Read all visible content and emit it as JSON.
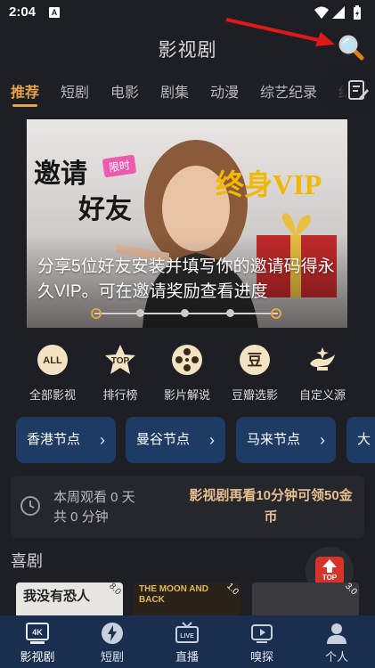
{
  "status": {
    "time": "2:04",
    "notif_icon_letter": "A"
  },
  "header": {
    "title": "影视剧",
    "search_icon": "search-icon"
  },
  "tabs": [
    {
      "label": "推荐",
      "active": true
    },
    {
      "label": "短剧"
    },
    {
      "label": "电影"
    },
    {
      "label": "剧集"
    },
    {
      "label": "动漫"
    },
    {
      "label": "综艺纪录"
    },
    {
      "label": "纪"
    }
  ],
  "banner": {
    "headline_1": "邀请",
    "headline_2": "好友",
    "badge": "限时",
    "tagline": "终身VIP",
    "caption": "分享5位好友安装并填写你的邀请码得永久VIP。可在邀请奖励查看进度",
    "slide_count": 5,
    "active_slides": [
      0,
      4
    ]
  },
  "quick_links": [
    {
      "label": "全部影视",
      "icon": "all-icon",
      "icon_text": "ALL"
    },
    {
      "label": "排行榜",
      "icon": "top-ranking-icon",
      "icon_text": "TOP"
    },
    {
      "label": "影片解说",
      "icon": "film-reel-icon"
    },
    {
      "label": "豆瓣选影",
      "icon": "douban-icon",
      "icon_text": "豆"
    },
    {
      "label": "自定义源",
      "icon": "magic-lamp-icon"
    }
  ],
  "nodes": [
    {
      "label": "香港节点"
    },
    {
      "label": "曼谷节点"
    },
    {
      "label": "马来节点"
    },
    {
      "label": "大"
    }
  ],
  "watch": {
    "line1": "本周观看 0 天",
    "line2": "共 0 分钟",
    "promo": "影视剧再看10分钟可领50金币"
  },
  "section": {
    "title": "喜剧"
  },
  "top_button": {
    "label": "TOP"
  },
  "posters": [
    {
      "title": "我没有恐人",
      "score": "8.0"
    },
    {
      "title": "THE MOON AND BACK",
      "score": "1.0"
    },
    {
      "title": "",
      "score": "3.0"
    }
  ],
  "bottom_nav": [
    {
      "label": "影视剧",
      "icon": "4k-tv-icon",
      "active": true
    },
    {
      "label": "短剧",
      "icon": "lightning-icon"
    },
    {
      "label": "直播",
      "icon": "live-tv-icon"
    },
    {
      "label": "嗅探",
      "icon": "sniff-play-icon"
    },
    {
      "label": "个人",
      "icon": "person-icon"
    }
  ],
  "colors": {
    "accent": "#e7a447",
    "background": "#1e1f24",
    "node_bg": "#1d3b63",
    "bottom_nav_bg": "#1a2f50",
    "promo_text": "#e7bf8f"
  }
}
